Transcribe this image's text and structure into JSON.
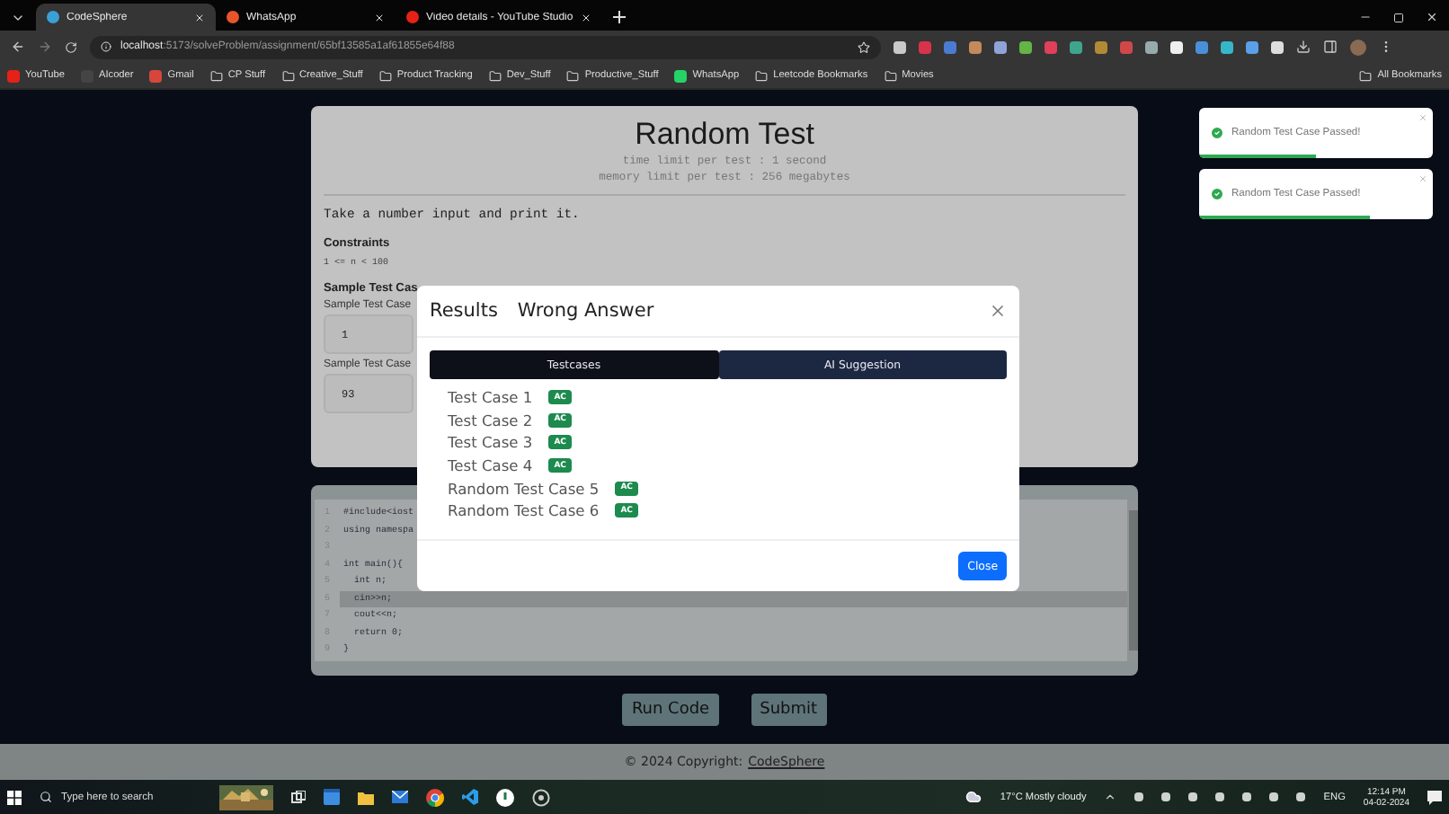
{
  "browser": {
    "tabs": [
      {
        "title": "CodeSphere",
        "selected": true
      },
      {
        "title": "WhatsApp",
        "selected": false
      },
      {
        "title": "Video details - YouTube Studio",
        "selected": false
      }
    ],
    "address": {
      "host": "localhost",
      "path": ":5173/solveProblem/assignment/65bf13585a1af61855e64f88"
    },
    "bookmarks": [
      {
        "label": "YouTube",
        "kind": "site"
      },
      {
        "label": "AIcoder",
        "kind": "site"
      },
      {
        "label": "Gmail",
        "kind": "site"
      },
      {
        "label": "CP Stuff",
        "kind": "folder"
      },
      {
        "label": "Creative_Stuff",
        "kind": "folder"
      },
      {
        "label": "Product Tracking",
        "kind": "folder"
      },
      {
        "label": "Dev_Stuff",
        "kind": "folder"
      },
      {
        "label": "Productive_Stuff",
        "kind": "folder"
      },
      {
        "label": "WhatsApp",
        "kind": "site"
      },
      {
        "label": "Leetcode Bookmarks",
        "kind": "folder"
      },
      {
        "label": "Movies",
        "kind": "folder"
      }
    ],
    "all_bookmarks": "All Bookmarks"
  },
  "problem": {
    "title": "Random Test",
    "time_limit": "time limit per test : 1 second",
    "memory_limit": "memory limit per test : 256 megabytes",
    "statement": "Take a number input and print it.",
    "constraints_heading": "Constraints",
    "constraints": "1 <= n < 100",
    "samples_heading": "Sample Test Cas",
    "samples": [
      {
        "label": "Sample Test Case",
        "value": "1"
      },
      {
        "label": "Sample Test Case",
        "value": "93"
      }
    ]
  },
  "editor": {
    "lines": [
      {
        "number": "1",
        "code": "#include<iost",
        "current": false
      },
      {
        "number": "2",
        "code": "using namespa",
        "current": false
      },
      {
        "number": "3",
        "current": false
      },
      {
        "number": "4",
        "code": "int main(){",
        "current": false
      },
      {
        "number": "5",
        "code": "  int n;",
        "current": false
      },
      {
        "number": "6",
        "code": "  cin>>n;",
        "current": true
      },
      {
        "number": "7",
        "code": "  cout<<n;",
        "current": false
      },
      {
        "number": "8",
        "code": "  return 0;",
        "current": false
      },
      {
        "number": "9",
        "code": "}",
        "current": false
      }
    ]
  },
  "actions": [
    "Run Code",
    "Submit"
  ],
  "footer": {
    "text": "© 2024 Copyright:",
    "link": "CodeSphere"
  },
  "modal": {
    "title": "Results",
    "verdict": "Wrong Answer",
    "tabs": [
      {
        "label": "Testcases",
        "selected": true
      },
      {
        "label": "AI Suggestion",
        "selected": false
      }
    ],
    "results": [
      {
        "name": "Test Case 1",
        "badge": "AC"
      },
      {
        "name": "Test Case 2",
        "badge": "AC"
      },
      {
        "name": "Test Case 3",
        "badge": "AC"
      },
      {
        "name": "Test Case 4",
        "badge": "AC"
      },
      {
        "name": "Random Test Case 5",
        "badge": "AC"
      },
      {
        "name": "Random Test Case 6",
        "badge": "AC"
      }
    ],
    "close_button": "Close"
  },
  "toasts": [
    {
      "message": "Random Test Case Passed!",
      "level": 0.5
    },
    {
      "message": "Random Test Case Passed!",
      "level": 0.73
    }
  ],
  "taskbar": {
    "search_placeholder": "Type here to search",
    "weather": "17°C  Mostly cloudy",
    "language": "ENG",
    "time": "12:14 PM",
    "date": "04-02-2024"
  }
}
